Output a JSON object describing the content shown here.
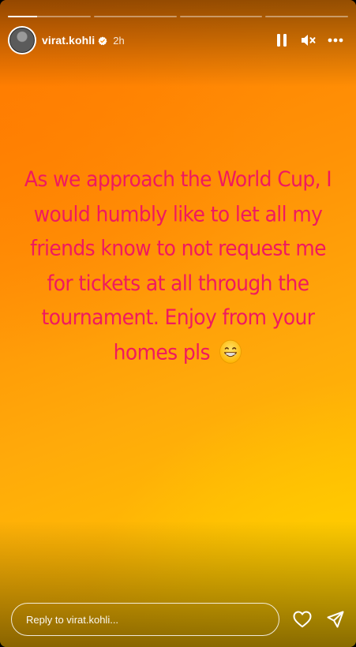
{
  "story": {
    "progress": [
      {
        "fill": 0.35
      },
      {
        "fill": 0
      },
      {
        "fill": 0
      },
      {
        "fill": 0
      }
    ],
    "header": {
      "username": "virat.kohli",
      "time": "2h"
    },
    "caption": {
      "text": "As we approach the World Cup, I would humbly like to let all my friends know to not request me for tickets at all through the tournament. Enjoy from your homes pls",
      "emoji": "grinning-face-emoji",
      "color": "#f0195f"
    },
    "reply": {
      "placeholder": "Reply to virat.kohli..."
    },
    "icons": {
      "verified": "verified-badge-icon",
      "pause": "pause-icon",
      "mute": "mute-icon",
      "more": "more-options-icon",
      "like": "heart-icon",
      "share": "send-icon"
    }
  }
}
